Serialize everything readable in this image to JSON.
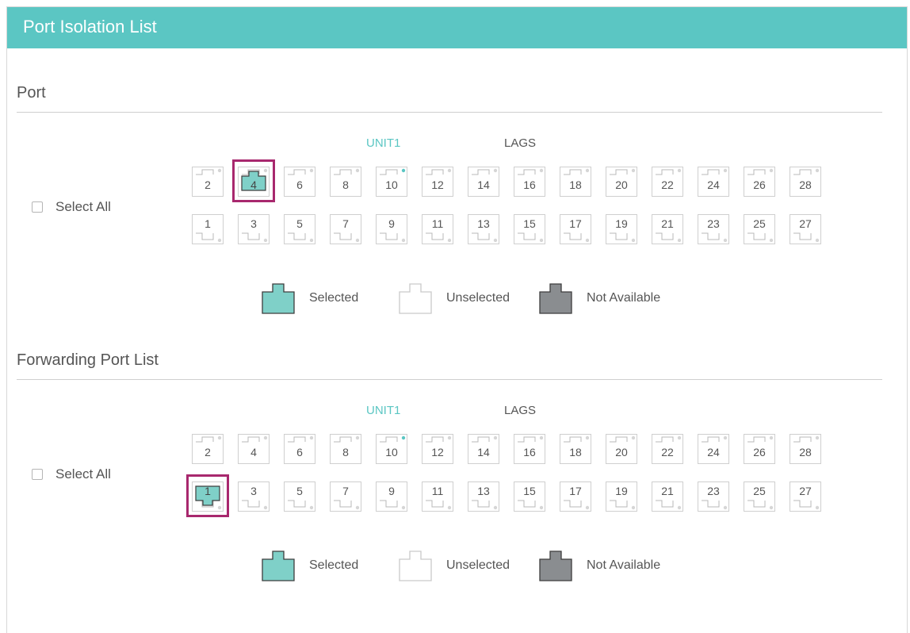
{
  "header": {
    "title": "Port Isolation List"
  },
  "sections": [
    {
      "title": "Port",
      "unit_label": "UNIT1",
      "lags_label": "LAGS",
      "select_all_label": "Select All",
      "top_row": [
        "2",
        "4",
        "6",
        "8",
        "10",
        "12",
        "14",
        "16",
        "18",
        "20",
        "22",
        "24",
        "26",
        "28"
      ],
      "bottom_row": [
        "1",
        "3",
        "5",
        "7",
        "9",
        "11",
        "13",
        "15",
        "17",
        "19",
        "21",
        "23",
        "25",
        "27"
      ],
      "selected": [
        "4"
      ],
      "highlighted": [
        "4"
      ],
      "active_dot": [
        "10"
      ]
    },
    {
      "title": "Forwarding Port List",
      "unit_label": "UNIT1",
      "lags_label": "LAGS",
      "select_all_label": "Select All",
      "top_row": [
        "2",
        "4",
        "6",
        "8",
        "10",
        "12",
        "14",
        "16",
        "18",
        "20",
        "22",
        "24",
        "26",
        "28"
      ],
      "bottom_row": [
        "1",
        "3",
        "5",
        "7",
        "9",
        "11",
        "13",
        "15",
        "17",
        "19",
        "21",
        "23",
        "25",
        "27"
      ],
      "selected": [
        "1"
      ],
      "highlighted": [
        "1"
      ],
      "active_dot": [
        "10"
      ]
    }
  ],
  "legend": {
    "selected": "Selected",
    "unselected": "Unselected",
    "not_available": "Not Available"
  },
  "colors": {
    "accent": "#5bc6c3",
    "selected_fill": "#7fd0c8",
    "not_available_fill": "#8a8d90",
    "highlight": "#a8286e"
  }
}
